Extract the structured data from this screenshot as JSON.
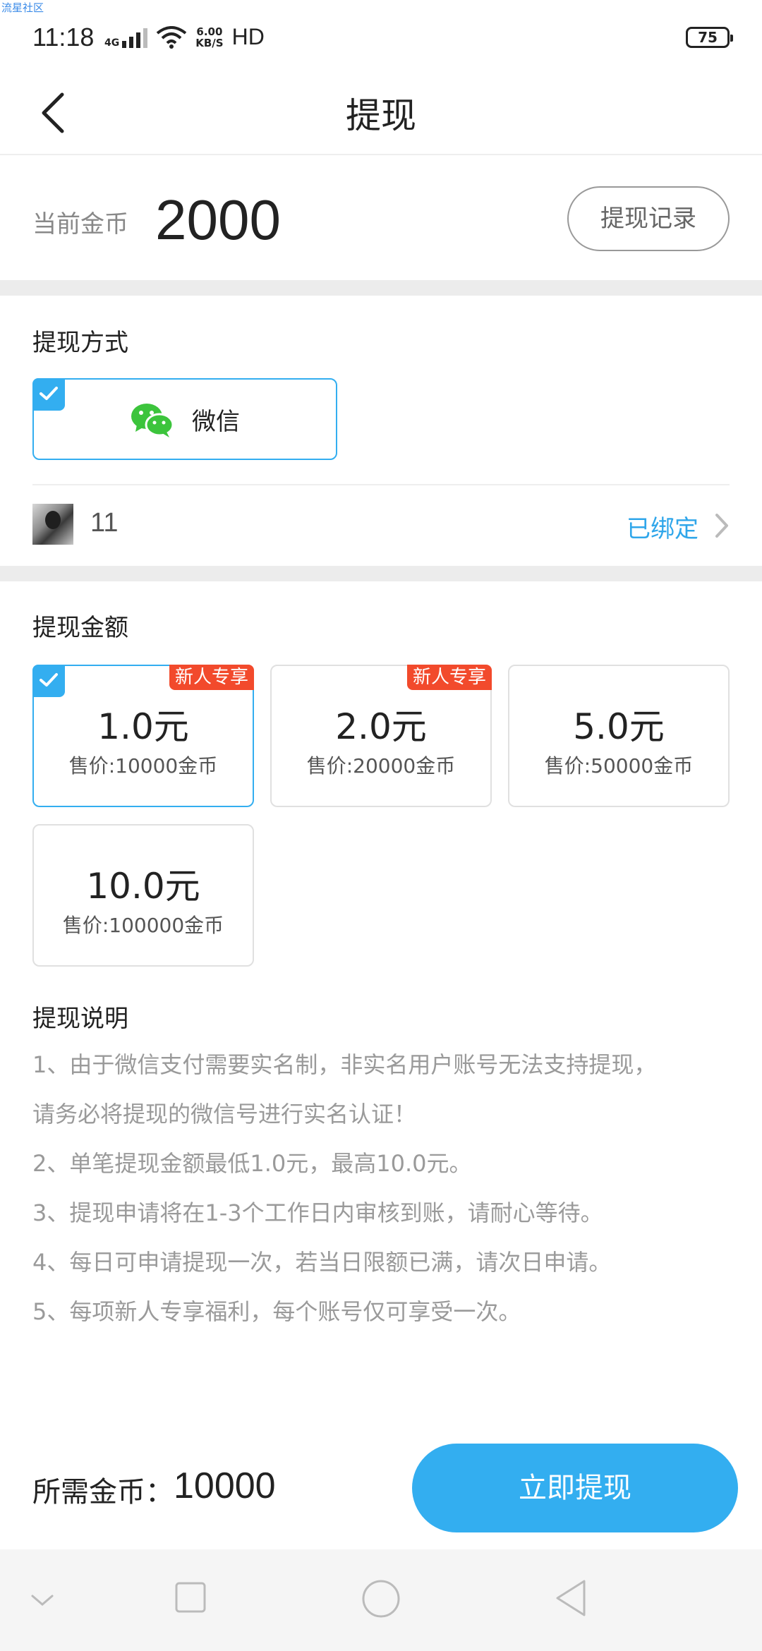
{
  "watermark": "流星社区",
  "status_bar": {
    "time": "11:18",
    "network": "4G",
    "speed_value": "6.00",
    "speed_unit": "KB/S",
    "hd": "HD",
    "battery": "75"
  },
  "header": {
    "title": "提现"
  },
  "coins": {
    "label": "当前金币",
    "value": "2000",
    "history_button": "提现记录"
  },
  "method_section": {
    "title": "提现方式",
    "method_label": "微信",
    "account_name": "11",
    "bound_status": "已绑定"
  },
  "amount_section": {
    "title": "提现金额",
    "options": [
      {
        "amount": "1.0元",
        "price": "售价:10000金币",
        "tag": "新人专享",
        "selected": true
      },
      {
        "amount": "2.0元",
        "price": "售价:20000金币",
        "tag": "新人专享",
        "selected": false
      },
      {
        "amount": "5.0元",
        "price": "售价:50000金币",
        "tag": "",
        "selected": false
      },
      {
        "amount": "10.0元",
        "price": "售价:100000金币",
        "tag": "",
        "selected": false
      }
    ]
  },
  "notes": {
    "title": "提现说明",
    "lines": [
      "1、由于微信支付需要实名制，非实名用户账号无法支持提现，",
      "请务必将提现的微信号进行实名认证！",
      "2、单笔提现金额最低1.0元，最高10.0元。",
      "3、提现申请将在1-3个工作日内审核到账，请耐心等待。",
      "4、每日可申请提现一次，若当日限额已满，请次日申请。",
      "5、每项新人专享福利，每个账号仅可享受一次。"
    ]
  },
  "footer": {
    "required_label": "所需金币：",
    "required_value": "10000",
    "submit_button": "立即提现"
  },
  "colors": {
    "accent": "#33aef0",
    "promo": "#f24a2c",
    "bound": "#2fa6ea",
    "wechat": "#3cc43c"
  },
  "icons": [
    "back-icon",
    "wechat-icon",
    "check-icon",
    "chevron-right-icon",
    "wifi-icon",
    "signal-icon",
    "battery-icon",
    "nav-back-icon",
    "nav-home-icon",
    "nav-recents-icon",
    "nav-collapse-icon"
  ]
}
